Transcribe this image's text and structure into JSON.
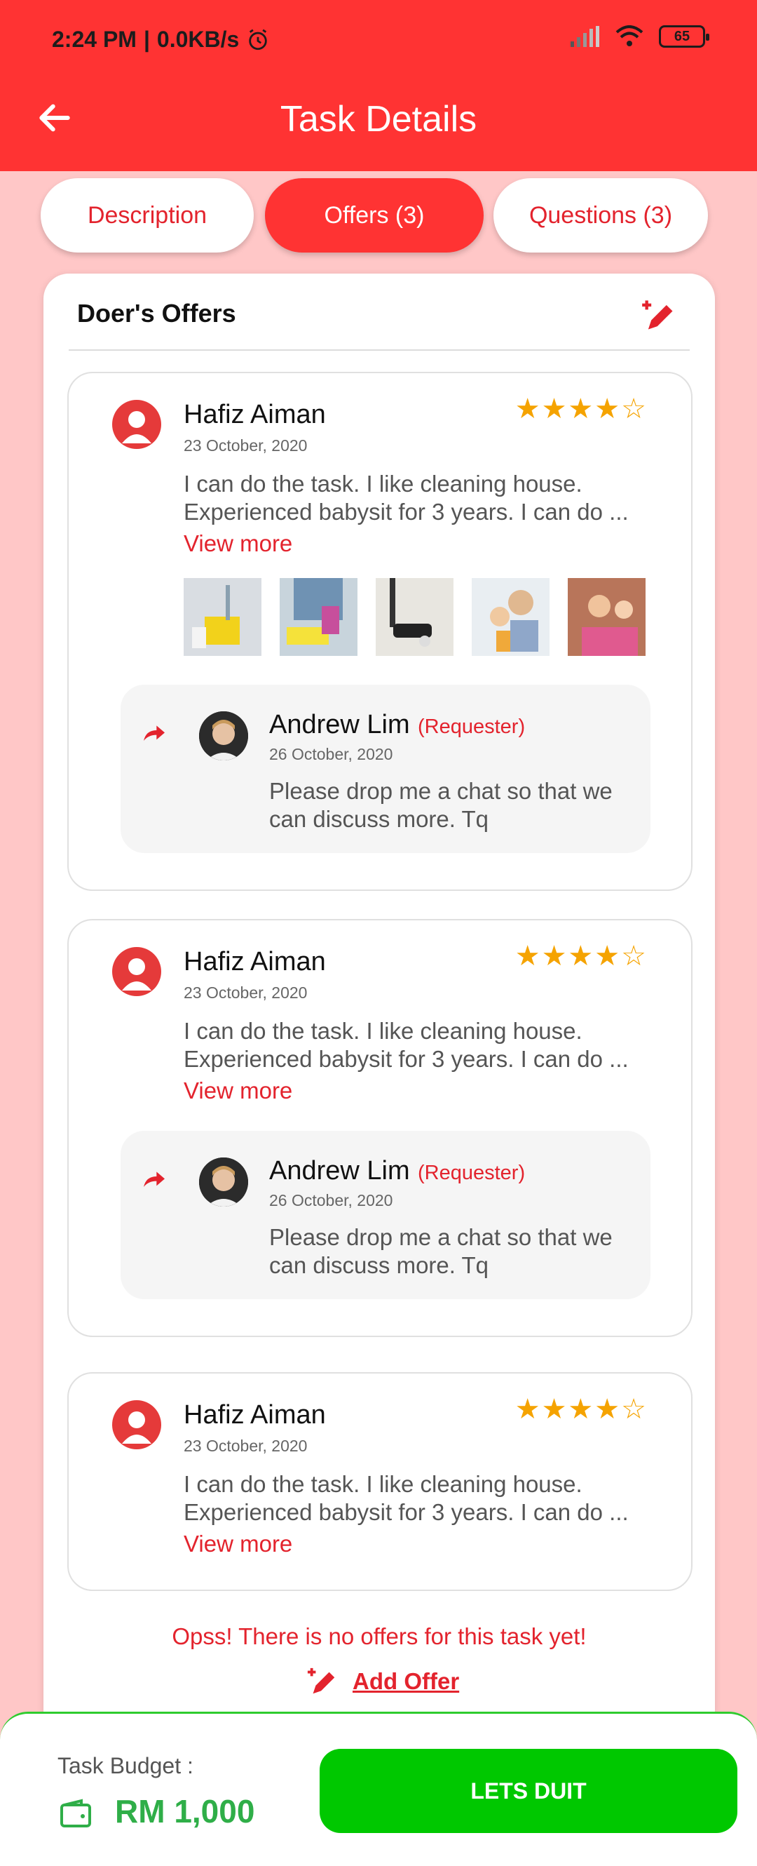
{
  "status": {
    "time": "2:24 PM",
    "net": "0.0KB/s",
    "battery": "65"
  },
  "header": {
    "title": "Task Details"
  },
  "tabs": [
    {
      "label": "Description"
    },
    {
      "label": "Offers (3)"
    },
    {
      "label": "Questions (3)"
    }
  ],
  "section": {
    "title": "Doer's Offers"
  },
  "offers": [
    {
      "name": "Hafiz Aiman",
      "date": "23 October, 2020",
      "rating": "★★★★☆",
      "line1": "I can do the task. I like cleaning house.",
      "line2": "Experienced babysit for 3 years.  I can do ...",
      "view_more": "View more",
      "reply": {
        "name": "Andrew Lim",
        "role": "(Requester)",
        "date": "26 October, 2020",
        "text": "Please drop me a chat so that we can discuss more. Tq"
      }
    },
    {
      "name": "Hafiz Aiman",
      "date": "23 October, 2020",
      "rating": "★★★★☆",
      "line1": "I can do the task. I like cleaning house.",
      "line2": "Experienced babysit for 3 years.  I can do ...",
      "view_more": "View more",
      "reply": {
        "name": "Andrew Lim",
        "role": "(Requester)",
        "date": "26 October, 2020",
        "text": "Please drop me a chat so that we can discuss more. Tq"
      }
    },
    {
      "name": "Hafiz Aiman",
      "date": "23 October, 2020",
      "rating": "★★★★☆",
      "line1": "I can do the task. I like cleaning house.",
      "line2": "Experienced babysit for 3 years.  I can do ...",
      "view_more": "View more"
    }
  ],
  "empty_message": "Opss! There is no offers for this task yet!",
  "add_offer": "Add Offer",
  "footer": {
    "budget_label": "Task Budget :",
    "budget_value": "RM 1,000",
    "cta": "LETS DUIT"
  },
  "colors": {
    "primary": "#ff3333",
    "accent_red": "#e3232d",
    "green": "#00c800",
    "star": "#f5a300"
  }
}
